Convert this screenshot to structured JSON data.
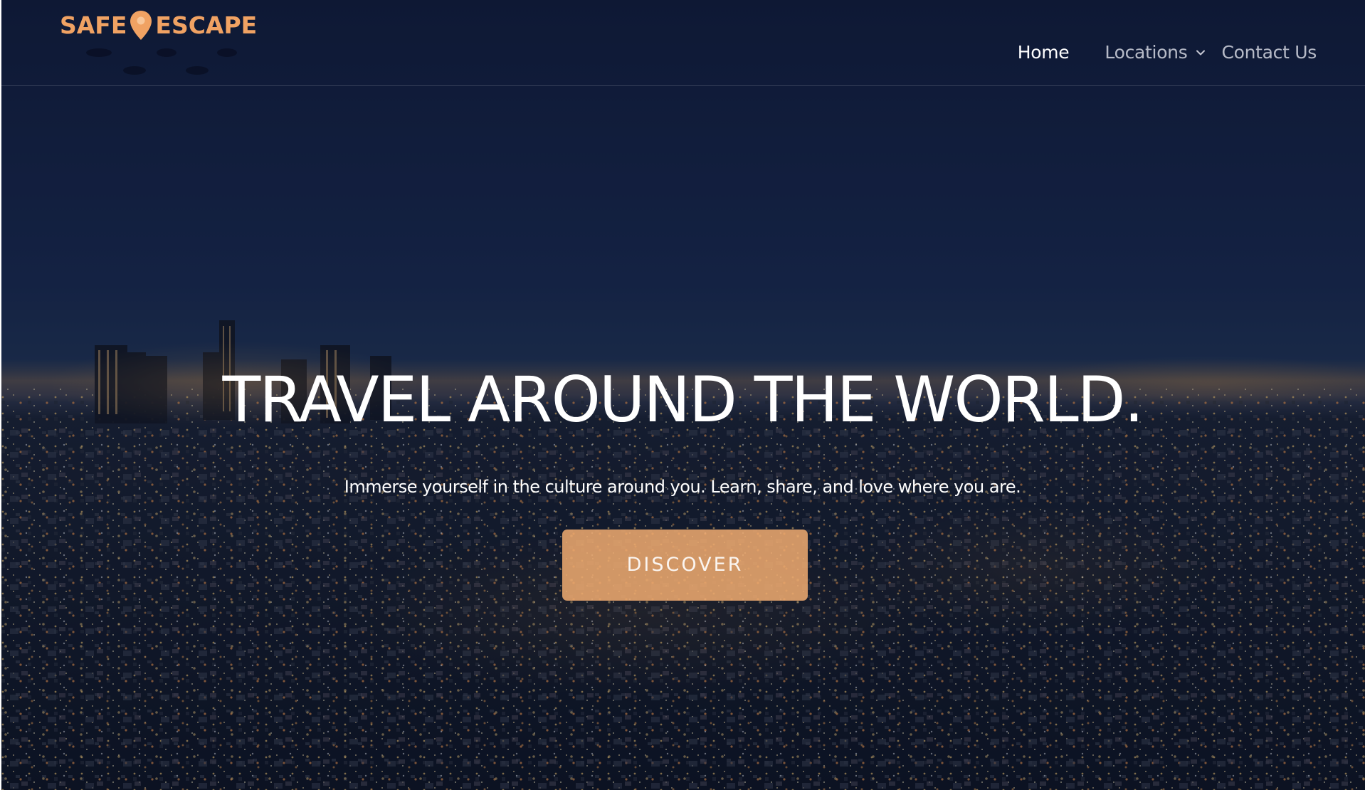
{
  "brand": {
    "name_left": "SAFE",
    "name_right": "ESCAPE",
    "color": "#f0a263",
    "pin_icon": "map-pin-icon"
  },
  "nav": {
    "items": [
      {
        "label": "Home",
        "active": true
      },
      {
        "label": "Locations",
        "has_dropdown": true,
        "dropdown_icon": "chevron-down-icon"
      },
      {
        "label": "Contact Us"
      }
    ]
  },
  "hero": {
    "title": "TRAVEL AROUND THE WORLD.",
    "subtitle": "Immerse yourself in the culture around you. Learn, share, and love where you are.",
    "cta_label": "DISCOVER",
    "cta_color": "#f0ab70",
    "background_image": "night city skyline aerial view"
  }
}
